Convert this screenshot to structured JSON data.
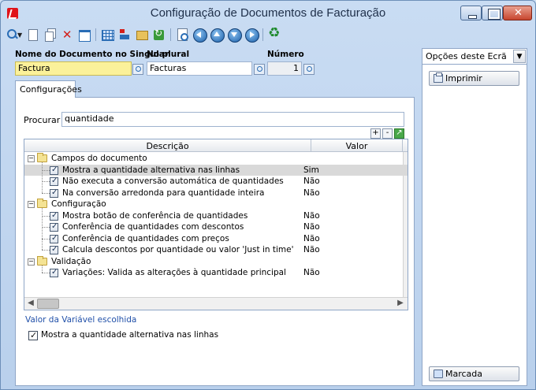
{
  "window": {
    "title": "Configuração de Documentos de Facturação"
  },
  "header": {
    "singular_label": "Nome do Documento no Singular",
    "singular_value": "Factura",
    "plural_label": "No plural",
    "plural_value": "Facturas",
    "numero_label": "Número",
    "numero_value": "1"
  },
  "tabs": [
    {
      "label": "Configurações"
    }
  ],
  "search": {
    "label": "Procurar :",
    "value": "quantidade"
  },
  "grid": {
    "columns": [
      "Descrição",
      "Valor"
    ],
    "groups": [
      {
        "name": "Campos do documento",
        "items": [
          {
            "label": "Mostra a quantidade alternativa nas linhas",
            "value": "Sim",
            "selected": true
          },
          {
            "label": "Não executa a conversão automática de quantidades",
            "value": "Não"
          },
          {
            "label": "Na conversão arredonda para quantidade inteira",
            "value": "Não"
          }
        ]
      },
      {
        "name": "Configuração",
        "items": [
          {
            "label": "Mostra botão de conferência de quantidades",
            "value": "Não"
          },
          {
            "label": "Conferência de quantidades com descontos",
            "value": "Não"
          },
          {
            "label": "Conferência de quantidades com preços",
            "value": "Não"
          },
          {
            "label": "Calcula descontos por quantidade ou valor 'Just in time'",
            "value": "Não"
          }
        ]
      },
      {
        "name": "Validação",
        "items": [
          {
            "label": "Variações: Valida as alterações à quantidade principal",
            "value": "Não"
          }
        ]
      }
    ]
  },
  "variable": {
    "label": "Valor da Variável escolhida",
    "checkbox_label": "Mostra a quantidade alternativa nas linhas",
    "checked": true
  },
  "side": {
    "options_label": "Opções deste Ecrã",
    "print_button": "Imprimir",
    "marked_button": "Marcada"
  }
}
